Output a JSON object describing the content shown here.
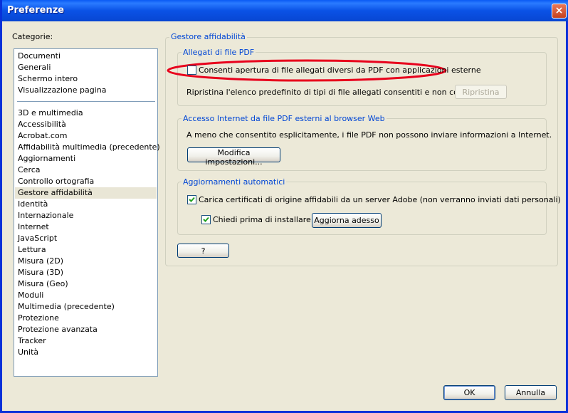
{
  "window": {
    "title": "Preferenze",
    "close_glyph": "×"
  },
  "categories": {
    "label": "Categorie:",
    "group1": [
      "Documenti",
      "Generali",
      "Schermo intero",
      "Visualizzazione pagina"
    ],
    "group2": [
      "3D e multimedia",
      "Accessibilità",
      "Acrobat.com",
      "Affidabilità multimedia (precedente)",
      "Aggiornamenti",
      "Cerca",
      "Controllo ortografia",
      "Gestore affidabilità",
      "Identità",
      "Internazionale",
      "Internet",
      "JavaScript",
      "Lettura",
      "Misura (2D)",
      "Misura (3D)",
      "Misura (Geo)",
      "Moduli",
      "Multimedia (precedente)",
      "Protezione",
      "Protezione avanzata",
      "Tracker",
      "Unità"
    ],
    "selected": "Gestore affidabilità"
  },
  "main": {
    "section_title": "Gestore affidabilità",
    "attachments": {
      "title": "Allegati di file PDF",
      "allow_checkbox": {
        "label": "Consenti apertura di file allegati diversi da PDF con applicazioni esterne",
        "checked": false
      },
      "restore_text": "Ripristina l'elenco predefinito di tipi di file allegati consentiti e non consentiti:",
      "restore_button": "Ripristina",
      "highlight_color": "#E8001C"
    },
    "internet": {
      "title": "Accesso Internet da file PDF esterni al browser Web",
      "text": "A meno che consentito esplicitamente, i file PDF non possono inviare informazioni a Internet.",
      "button": "Modifica impostazioni..."
    },
    "updates": {
      "title": "Aggiornamenti automatici",
      "load_certs_checkbox": {
        "label": "Carica certificati di origine affidabili da un server Adobe (non verranno inviati dati personali)",
        "checked": true
      },
      "ask_checkbox": {
        "label": "Chiedi prima di installare",
        "checked": true
      },
      "update_button": "Aggiorna adesso"
    },
    "help_button": "?"
  },
  "footer": {
    "ok": "OK",
    "cancel": "Annulla"
  }
}
